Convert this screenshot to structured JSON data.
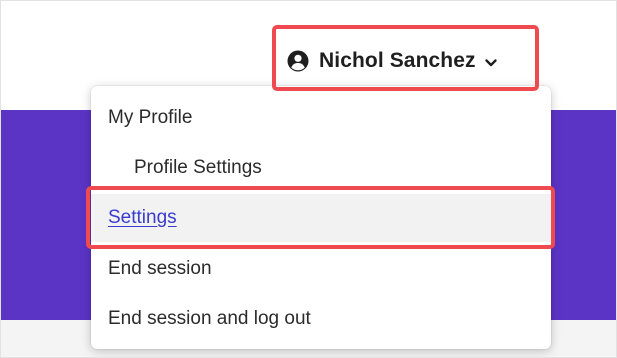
{
  "header": {
    "user_name": "Nichol Sanchez",
    "user_icon": "user-circle-icon",
    "dropdown_icon": "chevron-down-icon"
  },
  "menu": {
    "items": [
      {
        "label": "My Profile",
        "indent": false,
        "link": false
      },
      {
        "label": "Profile Settings",
        "indent": true,
        "link": false
      },
      {
        "label": "Settings",
        "indent": false,
        "link": true
      },
      {
        "label": "End session",
        "indent": false,
        "link": false
      },
      {
        "label": "End session and log out",
        "indent": false,
        "link": false
      }
    ]
  },
  "colors": {
    "accent_purple": "#5b34c6",
    "highlight_red": "#ef4a4f",
    "link_blue": "#3a3ccb"
  }
}
